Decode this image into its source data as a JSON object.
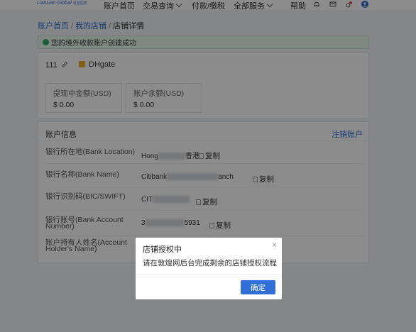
{
  "nav": {
    "logo": "LianLian Global",
    "logo_sub": "連連國際",
    "items": [
      "账户首页",
      "交易查询",
      "付款/缴税",
      "全部服务"
    ],
    "help": "帮助"
  },
  "breadcrumb": [
    "账户首页",
    "我的店铺",
    "店铺详情"
  ],
  "success_message": "您的境外收款账户创建成功",
  "store": {
    "number": "111",
    "platform": "DHgate"
  },
  "balances": [
    {
      "label": "提现中金额(USD)",
      "value": "$ 0.00"
    },
    {
      "label": "账户余额(USD)",
      "value": "$ 0.00"
    }
  ],
  "account_info": {
    "title": "账户信息",
    "close_link": "注销账户",
    "rows": [
      {
        "label": "银行所在地(Bank Location)",
        "value_start": "Hong",
        "value_end": "香港"
      },
      {
        "label": "银行名称(Bank Name)",
        "value_start": "Citibank",
        "value_end": "anch"
      },
      {
        "label": "银行识别码(BIC/SWIFT)",
        "value_start": "CIT",
        "value_end": ""
      },
      {
        "label": "银行账号(Bank Account Number)",
        "value_start": "3",
        "value_end": "5931"
      },
      {
        "label": "账户持有人姓名(Account Holder's Name)",
        "value_start": "",
        "value_end": ""
      }
    ],
    "copy_label": "复制"
  },
  "modal": {
    "title": "店铺授权中",
    "body": "请在敦煌网后台完成剩余的店铺授权流程",
    "close_glyph": "×",
    "confirm_label": "确定"
  },
  "colors": {
    "primary": "#2f6fd6",
    "success": "#2cae63",
    "badge": "#f1a92a"
  }
}
